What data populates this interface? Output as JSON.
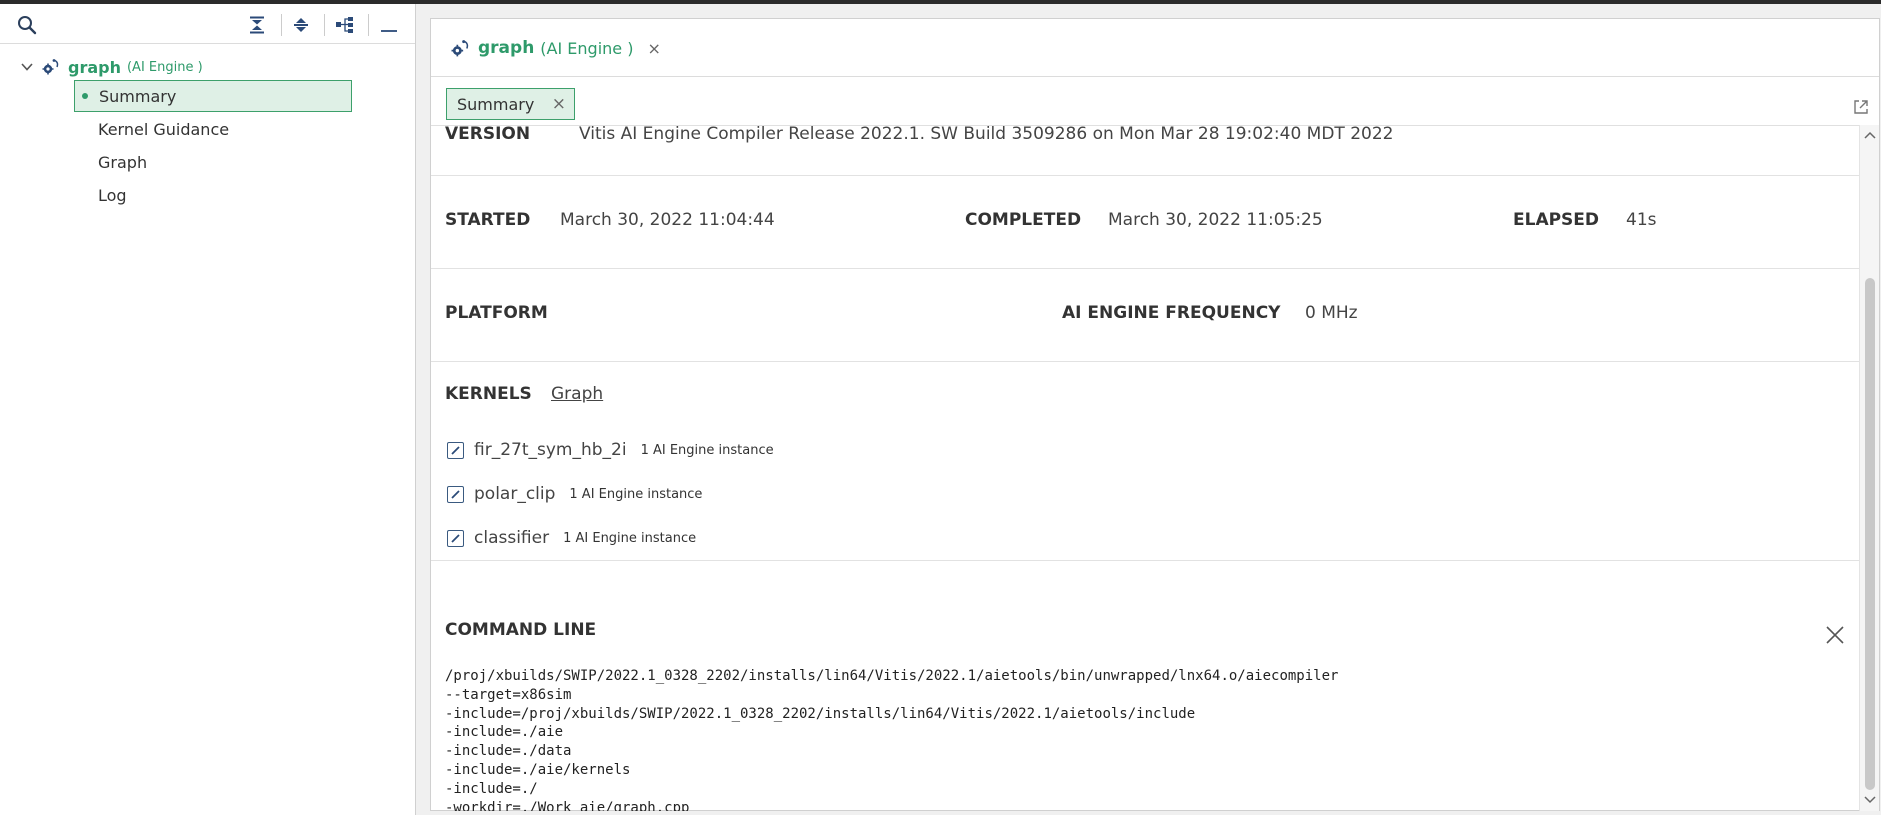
{
  "left_panel": {
    "toolbar": {
      "search_icon": "search-icon",
      "collapse_all_icon": "collapse-all-icon",
      "expand_all_icon": "expand-all-icon",
      "hierarchy_icon": "hierarchy-icon",
      "minimize_icon": "minimize-icon"
    },
    "tree": {
      "root_label": "graph",
      "root_sublabel": "(AI Engine )",
      "items": [
        {
          "label": "Summary",
          "active": true
        },
        {
          "label": "Kernel Guidance",
          "active": false
        },
        {
          "label": "Graph",
          "active": false
        },
        {
          "label": "Log",
          "active": false
        }
      ]
    }
  },
  "editor": {
    "tab": {
      "label": "graph",
      "sublabel": "(AI Engine )",
      "close": "×"
    },
    "subtab": {
      "label": "Summary",
      "close": "×"
    },
    "version": {
      "label": "VERSION",
      "value": "Vitis AI Engine Compiler Release 2022.1. SW Build 3509286 on Mon Mar 28 19:02:40 MDT 2022"
    },
    "started": {
      "label": "STARTED",
      "value": "March 30, 2022 11:04:44"
    },
    "completed": {
      "label": "COMPLETED",
      "value": "March 30, 2022 11:05:25"
    },
    "elapsed": {
      "label": "ELAPSED",
      "value": "41s"
    },
    "platform": {
      "label": "PLATFORM",
      "value": ""
    },
    "frequency": {
      "label": "AI ENGINE FREQUENCY",
      "value": "0 MHz"
    },
    "kernels": {
      "label": "KERNELS",
      "link": "Graph",
      "items": [
        {
          "name": "fir_27t_sym_hb_2i",
          "instances": "1 AI Engine instance"
        },
        {
          "name": "polar_clip",
          "instances": "1 AI Engine instance"
        },
        {
          "name": "classifier",
          "instances": "1 AI Engine instance"
        }
      ]
    },
    "command_line": {
      "label": "COMMAND LINE",
      "lines": [
        "/proj/xbuilds/SWIP/2022.1_0328_2202/installs/lin64/Vitis/2022.1/aietools/bin/unwrapped/lnx64.o/aiecompiler",
        "--target=x86sim",
        "-include=/proj/xbuilds/SWIP/2022.1_0328_2202/installs/lin64/Vitis/2022.1/aietools/include",
        "-include=./aie",
        "-include=./data",
        "-include=./aie/kernels",
        "-include=./",
        "-workdir=./Work aie/graph.cpp"
      ]
    }
  }
}
